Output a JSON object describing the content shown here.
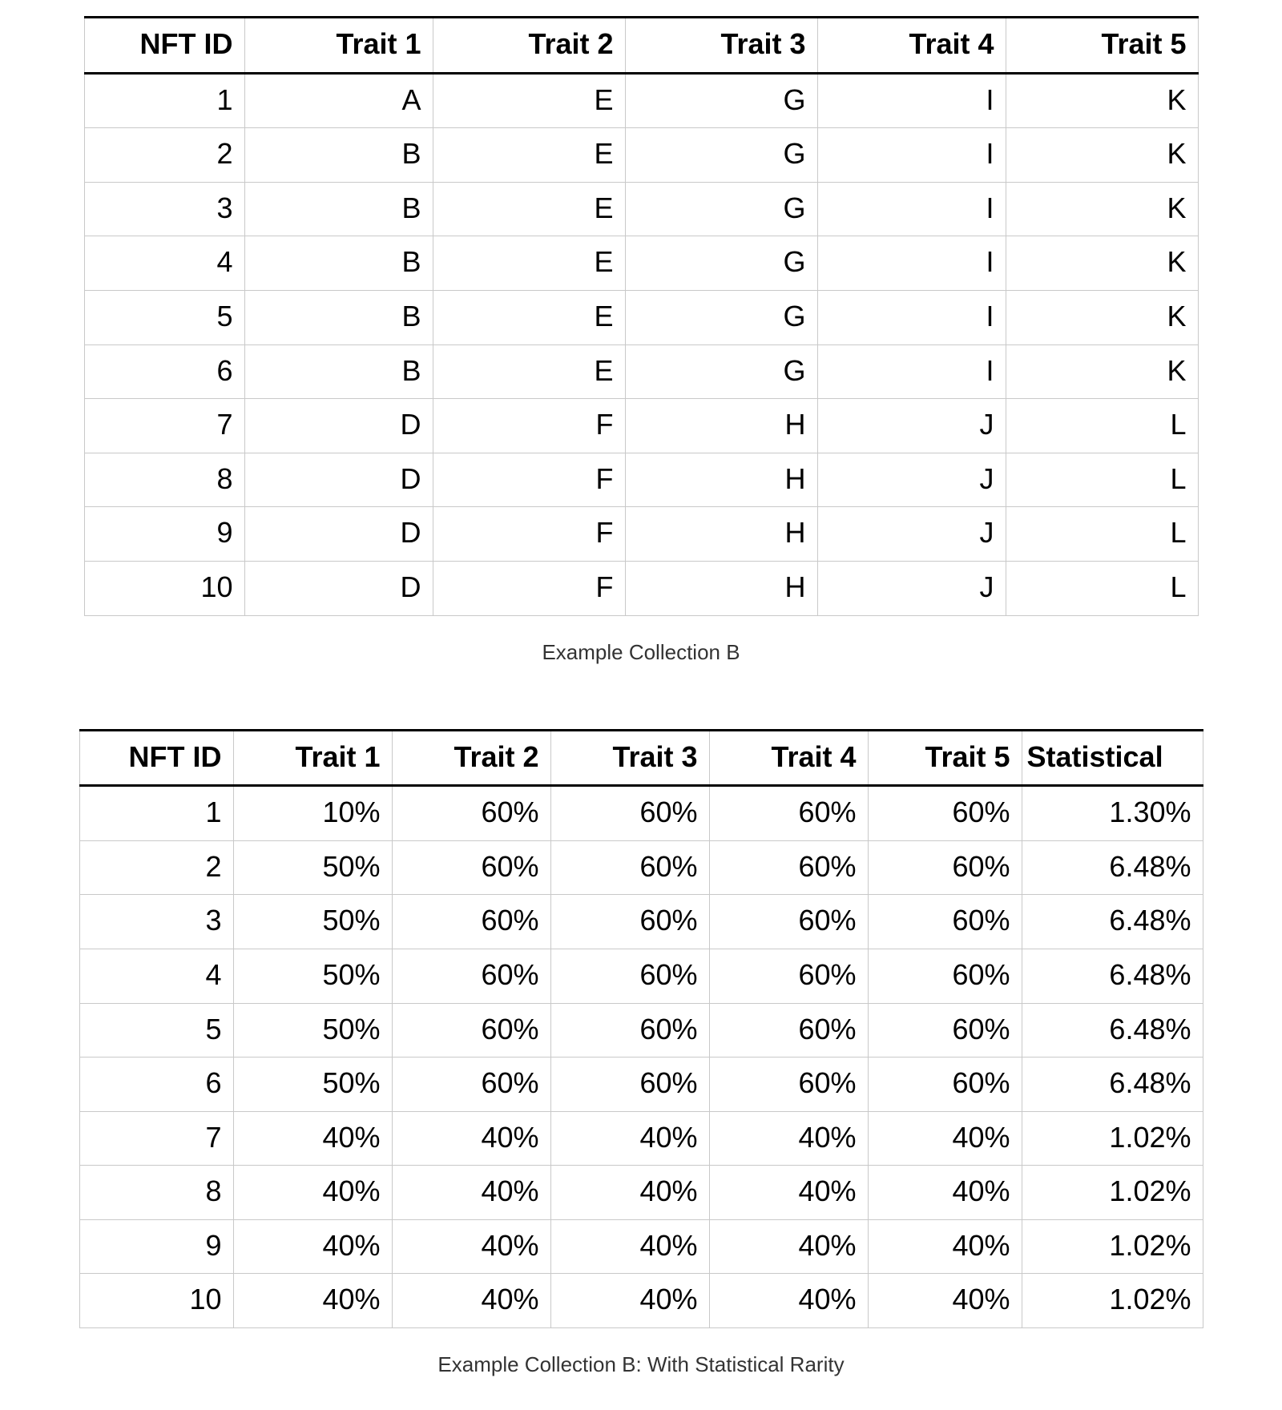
{
  "table1": {
    "headers": [
      "NFT ID",
      "Trait 1",
      "Trait 2",
      "Trait 3",
      "Trait 4",
      "Trait 5"
    ],
    "rows": [
      [
        "1",
        "A",
        "E",
        "G",
        "I",
        "K"
      ],
      [
        "2",
        "B",
        "E",
        "G",
        "I",
        "K"
      ],
      [
        "3",
        "B",
        "E",
        "G",
        "I",
        "K"
      ],
      [
        "4",
        "B",
        "E",
        "G",
        "I",
        "K"
      ],
      [
        "5",
        "B",
        "E",
        "G",
        "I",
        "K"
      ],
      [
        "6",
        "B",
        "E",
        "G",
        "I",
        "K"
      ],
      [
        "7",
        "D",
        "F",
        "H",
        "J",
        "L"
      ],
      [
        "8",
        "D",
        "F",
        "H",
        "J",
        "L"
      ],
      [
        "9",
        "D",
        "F",
        "H",
        "J",
        "L"
      ],
      [
        "10",
        "D",
        "F",
        "H",
        "J",
        "L"
      ]
    ],
    "caption": "Example Collection B"
  },
  "table2": {
    "headers": [
      "NFT ID",
      "Trait 1",
      "Trait 2",
      "Trait 3",
      "Trait 4",
      "Trait 5",
      "Statistical"
    ],
    "rows": [
      [
        "1",
        "10%",
        "60%",
        "60%",
        "60%",
        "60%",
        "1.30%"
      ],
      [
        "2",
        "50%",
        "60%",
        "60%",
        "60%",
        "60%",
        "6.48%"
      ],
      [
        "3",
        "50%",
        "60%",
        "60%",
        "60%",
        "60%",
        "6.48%"
      ],
      [
        "4",
        "50%",
        "60%",
        "60%",
        "60%",
        "60%",
        "6.48%"
      ],
      [
        "5",
        "50%",
        "60%",
        "60%",
        "60%",
        "60%",
        "6.48%"
      ],
      [
        "6",
        "50%",
        "60%",
        "60%",
        "60%",
        "60%",
        "6.48%"
      ],
      [
        "7",
        "40%",
        "40%",
        "40%",
        "40%",
        "40%",
        "1.02%"
      ],
      [
        "8",
        "40%",
        "40%",
        "40%",
        "40%",
        "40%",
        "1.02%"
      ],
      [
        "9",
        "40%",
        "40%",
        "40%",
        "40%",
        "40%",
        "1.02%"
      ],
      [
        "10",
        "40%",
        "40%",
        "40%",
        "40%",
        "40%",
        "1.02%"
      ]
    ],
    "caption": "Example Collection B: With Statistical Rarity"
  },
  "chart_data": [
    {
      "type": "table",
      "title": "Example Collection B",
      "columns": [
        "NFT ID",
        "Trait 1",
        "Trait 2",
        "Trait 3",
        "Trait 4",
        "Trait 5"
      ],
      "rows": [
        {
          "NFT ID": 1,
          "Trait 1": "A",
          "Trait 2": "E",
          "Trait 3": "G",
          "Trait 4": "I",
          "Trait 5": "K"
        },
        {
          "NFT ID": 2,
          "Trait 1": "B",
          "Trait 2": "E",
          "Trait 3": "G",
          "Trait 4": "I",
          "Trait 5": "K"
        },
        {
          "NFT ID": 3,
          "Trait 1": "B",
          "Trait 2": "E",
          "Trait 3": "G",
          "Trait 4": "I",
          "Trait 5": "K"
        },
        {
          "NFT ID": 4,
          "Trait 1": "B",
          "Trait 2": "E",
          "Trait 3": "G",
          "Trait 4": "I",
          "Trait 5": "K"
        },
        {
          "NFT ID": 5,
          "Trait 1": "B",
          "Trait 2": "E",
          "Trait 3": "G",
          "Trait 4": "I",
          "Trait 5": "K"
        },
        {
          "NFT ID": 6,
          "Trait 1": "B",
          "Trait 2": "E",
          "Trait 3": "G",
          "Trait 4": "I",
          "Trait 5": "K"
        },
        {
          "NFT ID": 7,
          "Trait 1": "D",
          "Trait 2": "F",
          "Trait 3": "H",
          "Trait 4": "J",
          "Trait 5": "L"
        },
        {
          "NFT ID": 8,
          "Trait 1": "D",
          "Trait 2": "F",
          "Trait 3": "H",
          "Trait 4": "J",
          "Trait 5": "L"
        },
        {
          "NFT ID": 9,
          "Trait 1": "D",
          "Trait 2": "F",
          "Trait 3": "H",
          "Trait 4": "J",
          "Trait 5": "L"
        },
        {
          "NFT ID": 10,
          "Trait 1": "D",
          "Trait 2": "F",
          "Trait 3": "H",
          "Trait 4": "J",
          "Trait 5": "L"
        }
      ]
    },
    {
      "type": "table",
      "title": "Example Collection B: With Statistical Rarity",
      "columns": [
        "NFT ID",
        "Trait 1",
        "Trait 2",
        "Trait 3",
        "Trait 4",
        "Trait 5",
        "Statistical"
      ],
      "rows": [
        {
          "NFT ID": 1,
          "Trait 1": 0.1,
          "Trait 2": 0.6,
          "Trait 3": 0.6,
          "Trait 4": 0.6,
          "Trait 5": 0.6,
          "Statistical": 0.013
        },
        {
          "NFT ID": 2,
          "Trait 1": 0.5,
          "Trait 2": 0.6,
          "Trait 3": 0.6,
          "Trait 4": 0.6,
          "Trait 5": 0.6,
          "Statistical": 0.0648
        },
        {
          "NFT ID": 3,
          "Trait 1": 0.5,
          "Trait 2": 0.6,
          "Trait 3": 0.6,
          "Trait 4": 0.6,
          "Trait 5": 0.6,
          "Statistical": 0.0648
        },
        {
          "NFT ID": 4,
          "Trait 1": 0.5,
          "Trait 2": 0.6,
          "Trait 3": 0.6,
          "Trait 4": 0.6,
          "Trait 5": 0.6,
          "Statistical": 0.0648
        },
        {
          "NFT ID": 5,
          "Trait 1": 0.5,
          "Trait 2": 0.6,
          "Trait 3": 0.6,
          "Trait 4": 0.6,
          "Trait 5": 0.6,
          "Statistical": 0.0648
        },
        {
          "NFT ID": 6,
          "Trait 1": 0.5,
          "Trait 2": 0.6,
          "Trait 3": 0.6,
          "Trait 4": 0.6,
          "Trait 5": 0.6,
          "Statistical": 0.0648
        },
        {
          "NFT ID": 7,
          "Trait 1": 0.4,
          "Trait 2": 0.4,
          "Trait 3": 0.4,
          "Trait 4": 0.4,
          "Trait 5": 0.4,
          "Statistical": 0.0102
        },
        {
          "NFT ID": 8,
          "Trait 1": 0.4,
          "Trait 2": 0.4,
          "Trait 3": 0.4,
          "Trait 4": 0.4,
          "Trait 5": 0.4,
          "Statistical": 0.0102
        },
        {
          "NFT ID": 9,
          "Trait 1": 0.4,
          "Trait 2": 0.4,
          "Trait 3": 0.4,
          "Trait 4": 0.4,
          "Trait 5": 0.4,
          "Statistical": 0.0102
        },
        {
          "NFT ID": 10,
          "Trait 1": 0.4,
          "Trait 2": 0.4,
          "Trait 3": 0.4,
          "Trait 4": 0.4,
          "Trait 5": 0.4,
          "Statistical": 0.0102
        }
      ]
    }
  ]
}
